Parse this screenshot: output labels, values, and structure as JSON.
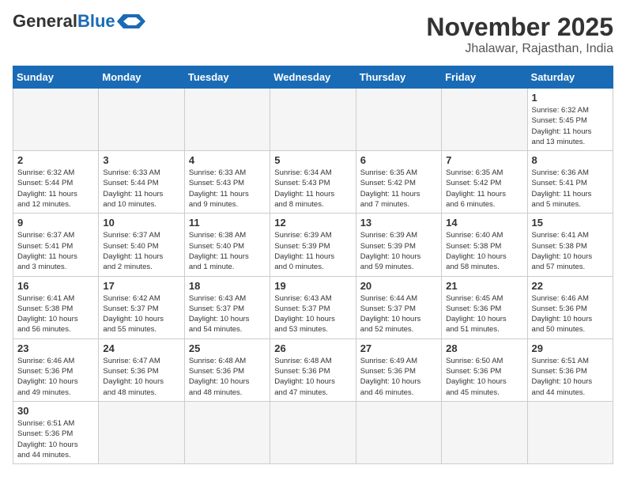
{
  "header": {
    "logo_general": "General",
    "logo_blue": "Blue",
    "month_year": "November 2025",
    "location": "Jhalawar, Rajasthan, India"
  },
  "weekdays": [
    "Sunday",
    "Monday",
    "Tuesday",
    "Wednesday",
    "Thursday",
    "Friday",
    "Saturday"
  ],
  "weeks": [
    [
      {
        "day": "",
        "info": ""
      },
      {
        "day": "",
        "info": ""
      },
      {
        "day": "",
        "info": ""
      },
      {
        "day": "",
        "info": ""
      },
      {
        "day": "",
        "info": ""
      },
      {
        "day": "",
        "info": ""
      },
      {
        "day": "1",
        "info": "Sunrise: 6:32 AM\nSunset: 5:45 PM\nDaylight: 11 hours\nand 13 minutes."
      }
    ],
    [
      {
        "day": "2",
        "info": "Sunrise: 6:32 AM\nSunset: 5:44 PM\nDaylight: 11 hours\nand 12 minutes."
      },
      {
        "day": "3",
        "info": "Sunrise: 6:33 AM\nSunset: 5:44 PM\nDaylight: 11 hours\nand 10 minutes."
      },
      {
        "day": "4",
        "info": "Sunrise: 6:33 AM\nSunset: 5:43 PM\nDaylight: 11 hours\nand 9 minutes."
      },
      {
        "day": "5",
        "info": "Sunrise: 6:34 AM\nSunset: 5:43 PM\nDaylight: 11 hours\nand 8 minutes."
      },
      {
        "day": "6",
        "info": "Sunrise: 6:35 AM\nSunset: 5:42 PM\nDaylight: 11 hours\nand 7 minutes."
      },
      {
        "day": "7",
        "info": "Sunrise: 6:35 AM\nSunset: 5:42 PM\nDaylight: 11 hours\nand 6 minutes."
      },
      {
        "day": "8",
        "info": "Sunrise: 6:36 AM\nSunset: 5:41 PM\nDaylight: 11 hours\nand 5 minutes."
      }
    ],
    [
      {
        "day": "9",
        "info": "Sunrise: 6:37 AM\nSunset: 5:41 PM\nDaylight: 11 hours\nand 3 minutes."
      },
      {
        "day": "10",
        "info": "Sunrise: 6:37 AM\nSunset: 5:40 PM\nDaylight: 11 hours\nand 2 minutes."
      },
      {
        "day": "11",
        "info": "Sunrise: 6:38 AM\nSunset: 5:40 PM\nDaylight: 11 hours\nand 1 minute."
      },
      {
        "day": "12",
        "info": "Sunrise: 6:39 AM\nSunset: 5:39 PM\nDaylight: 11 hours\nand 0 minutes."
      },
      {
        "day": "13",
        "info": "Sunrise: 6:39 AM\nSunset: 5:39 PM\nDaylight: 10 hours\nand 59 minutes."
      },
      {
        "day": "14",
        "info": "Sunrise: 6:40 AM\nSunset: 5:38 PM\nDaylight: 10 hours\nand 58 minutes."
      },
      {
        "day": "15",
        "info": "Sunrise: 6:41 AM\nSunset: 5:38 PM\nDaylight: 10 hours\nand 57 minutes."
      }
    ],
    [
      {
        "day": "16",
        "info": "Sunrise: 6:41 AM\nSunset: 5:38 PM\nDaylight: 10 hours\nand 56 minutes."
      },
      {
        "day": "17",
        "info": "Sunrise: 6:42 AM\nSunset: 5:37 PM\nDaylight: 10 hours\nand 55 minutes."
      },
      {
        "day": "18",
        "info": "Sunrise: 6:43 AM\nSunset: 5:37 PM\nDaylight: 10 hours\nand 54 minutes."
      },
      {
        "day": "19",
        "info": "Sunrise: 6:43 AM\nSunset: 5:37 PM\nDaylight: 10 hours\nand 53 minutes."
      },
      {
        "day": "20",
        "info": "Sunrise: 6:44 AM\nSunset: 5:37 PM\nDaylight: 10 hours\nand 52 minutes."
      },
      {
        "day": "21",
        "info": "Sunrise: 6:45 AM\nSunset: 5:36 PM\nDaylight: 10 hours\nand 51 minutes."
      },
      {
        "day": "22",
        "info": "Sunrise: 6:46 AM\nSunset: 5:36 PM\nDaylight: 10 hours\nand 50 minutes."
      }
    ],
    [
      {
        "day": "23",
        "info": "Sunrise: 6:46 AM\nSunset: 5:36 PM\nDaylight: 10 hours\nand 49 minutes."
      },
      {
        "day": "24",
        "info": "Sunrise: 6:47 AM\nSunset: 5:36 PM\nDaylight: 10 hours\nand 48 minutes."
      },
      {
        "day": "25",
        "info": "Sunrise: 6:48 AM\nSunset: 5:36 PM\nDaylight: 10 hours\nand 48 minutes."
      },
      {
        "day": "26",
        "info": "Sunrise: 6:48 AM\nSunset: 5:36 PM\nDaylight: 10 hours\nand 47 minutes."
      },
      {
        "day": "27",
        "info": "Sunrise: 6:49 AM\nSunset: 5:36 PM\nDaylight: 10 hours\nand 46 minutes."
      },
      {
        "day": "28",
        "info": "Sunrise: 6:50 AM\nSunset: 5:36 PM\nDaylight: 10 hours\nand 45 minutes."
      },
      {
        "day": "29",
        "info": "Sunrise: 6:51 AM\nSunset: 5:36 PM\nDaylight: 10 hours\nand 44 minutes."
      }
    ],
    [
      {
        "day": "30",
        "info": "Sunrise: 6:51 AM\nSunset: 5:36 PM\nDaylight: 10 hours\nand 44 minutes."
      },
      {
        "day": "",
        "info": ""
      },
      {
        "day": "",
        "info": ""
      },
      {
        "day": "",
        "info": ""
      },
      {
        "day": "",
        "info": ""
      },
      {
        "day": "",
        "info": ""
      },
      {
        "day": "",
        "info": ""
      }
    ]
  ]
}
